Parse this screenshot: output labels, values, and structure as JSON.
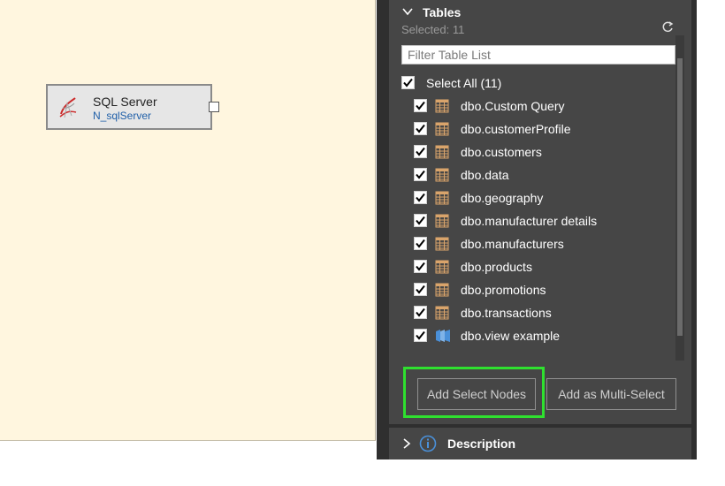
{
  "canvas": {
    "node": {
      "title": "SQL Server",
      "subtitle": "N_sqlServer"
    }
  },
  "tables_panel": {
    "header": "Tables",
    "selected_text": "Selected: 11",
    "filter_placeholder": "Filter Table List",
    "select_all_label": "Select All (11)",
    "items": [
      {
        "label": "dbo.Custom Query",
        "icon": "table-icon",
        "checked": true
      },
      {
        "label": "dbo.customerProfile",
        "icon": "table-icon",
        "checked": true
      },
      {
        "label": "dbo.customers",
        "icon": "table-icon",
        "checked": true
      },
      {
        "label": "dbo.data",
        "icon": "table-icon",
        "checked": true
      },
      {
        "label": "dbo.geography",
        "icon": "table-icon",
        "checked": true
      },
      {
        "label": "dbo.manufacturer details",
        "icon": "table-icon",
        "checked": true
      },
      {
        "label": "dbo.manufacturers",
        "icon": "table-icon",
        "checked": true
      },
      {
        "label": "dbo.products",
        "icon": "table-icon",
        "checked": true
      },
      {
        "label": "dbo.promotions",
        "icon": "table-icon",
        "checked": true
      },
      {
        "label": "dbo.transactions",
        "icon": "table-icon",
        "checked": true
      },
      {
        "label": "dbo.view example",
        "icon": "view-icon",
        "checked": true
      }
    ],
    "buttons": {
      "add_select_nodes": "Add Select Nodes",
      "add_multi_select": "Add as Multi-Select"
    }
  },
  "description_panel": {
    "header": "Description"
  },
  "colors": {
    "highlight": "#2fe02f",
    "panel_bg": "#464646",
    "canvas_bg": "#fff6df",
    "table_icon": "#d9a46b",
    "view_icon": "#4a90d9"
  }
}
